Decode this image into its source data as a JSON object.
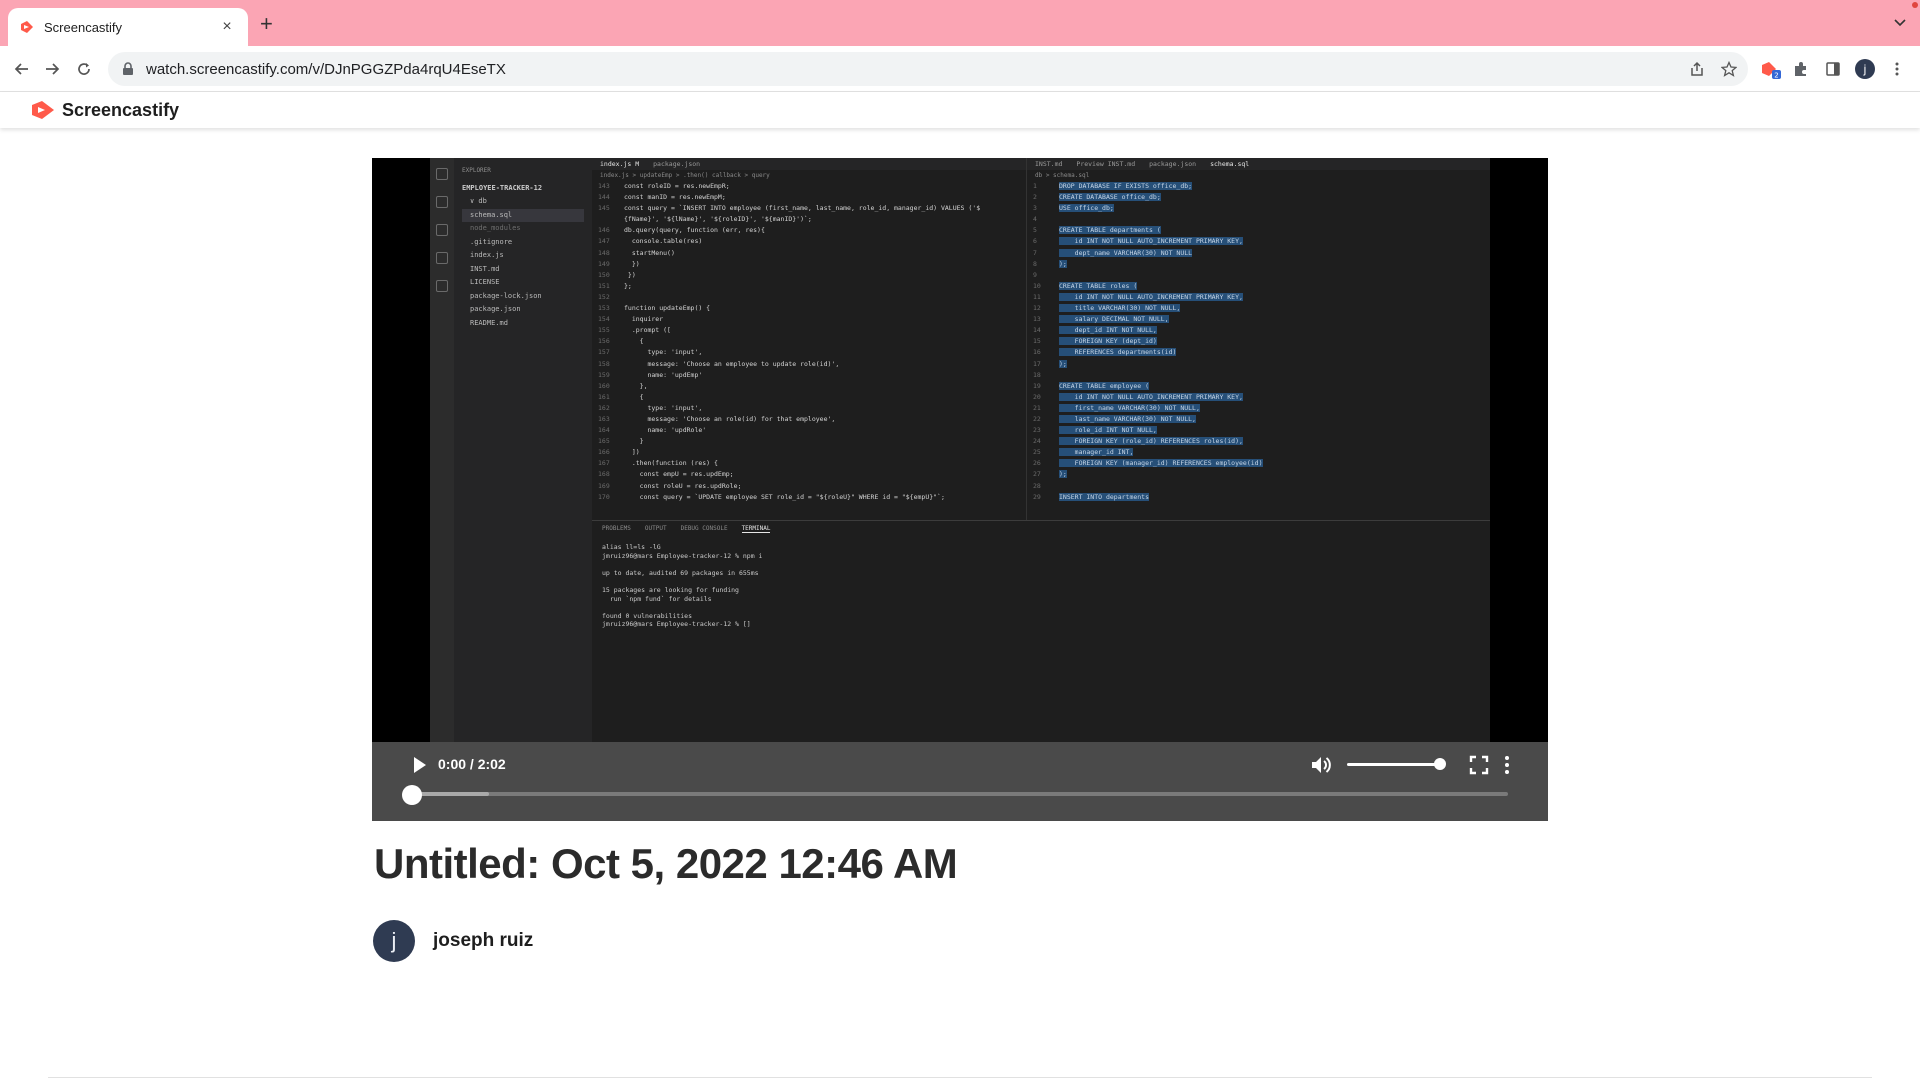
{
  "browser": {
    "tab_title": "Screencastify",
    "url": "watch.screencastify.com/v/DJnPGGZPda4rqU4EseTX",
    "extension_badge": "2",
    "profile_initial": "j"
  },
  "site": {
    "brand_name": "Screencastify",
    "brand_color": "#ff5a4a"
  },
  "player": {
    "time": "0:00 / 2:02",
    "progress_fraction": 0.0,
    "buffered_fraction": 0.07,
    "volume_fraction": 1.0
  },
  "screen_recording": {
    "explorer": {
      "title": "EXPLORER",
      "section": "EMPLOYEE-TRACKER-12",
      "items": [
        {
          "label": "db",
          "kind": "folder"
        },
        {
          "label": "schema.sql",
          "kind": "active"
        },
        {
          "label": "node_modules",
          "kind": "dim"
        },
        {
          "label": ".gitignore",
          "kind": "file"
        },
        {
          "label": "index.js",
          "kind": "file"
        },
        {
          "label": "INST.md",
          "kind": "file"
        },
        {
          "label": "LICENSE",
          "kind": "file"
        },
        {
          "label": "package-lock.json",
          "kind": "file"
        },
        {
          "label": "package.json",
          "kind": "file"
        },
        {
          "label": "README.md",
          "kind": "file"
        }
      ]
    },
    "left_tabs": [
      "index.js M",
      "package.json"
    ],
    "left_breadcrumb": "index.js > updateEmp > .then() callback > query",
    "left_code": [
      [
        "143",
        "const roleID = res.newEmpR;"
      ],
      [
        "144",
        "const manID = res.newEmpM;"
      ],
      [
        "145",
        "const query = `INSERT INTO employee (first_name, last_name, role_id, manager_id) VALUES ('$"
      ],
      [
        "",
        "{fName}', '${lName}', '${roleID}', '${manID}')`;"
      ],
      [
        "146",
        "db.query(query, function (err, res){"
      ],
      [
        "147",
        "  console.table(res)"
      ],
      [
        "148",
        "  startMenu()"
      ],
      [
        "149",
        "  })"
      ],
      [
        "150",
        " })"
      ],
      [
        "151",
        "};"
      ],
      [
        "152",
        ""
      ],
      [
        "153",
        "function updateEmp() {"
      ],
      [
        "154",
        "  inquirer"
      ],
      [
        "155",
        "  .prompt (["
      ],
      [
        "156",
        "    {"
      ],
      [
        "157",
        "      type: 'input',"
      ],
      [
        "158",
        "      message: 'Choose an employee to update role(id)',"
      ],
      [
        "159",
        "      name: 'updEmp'"
      ],
      [
        "160",
        "    },"
      ],
      [
        "161",
        "    {"
      ],
      [
        "162",
        "      type: 'input',"
      ],
      [
        "163",
        "      message: 'Choose an role(id) for that employee',"
      ],
      [
        "164",
        "      name: 'updRole'"
      ],
      [
        "165",
        "    }"
      ],
      [
        "166",
        "  ])"
      ],
      [
        "167",
        "  .then(function (res) {"
      ],
      [
        "168",
        "    const empU = res.updEmp;"
      ],
      [
        "169",
        "    const roleU = res.updRole;"
      ],
      [
        "170",
        "    const query = `UPDATE employee SET role_id = \"${roleU}\" WHERE id = \"${empU}\"`;"
      ]
    ],
    "right_tabs": [
      "INST.md",
      "Preview INST.md",
      "package.json",
      "schema.sql"
    ],
    "right_breadcrumb": "db > schema.sql",
    "right_code": [
      [
        "1",
        "DROP DATABASE IF EXISTS office_db;"
      ],
      [
        "2",
        "CREATE DATABASE office_db;"
      ],
      [
        "3",
        "USE office_db;"
      ],
      [
        "4",
        ""
      ],
      [
        "5",
        "CREATE TABLE departments ("
      ],
      [
        "6",
        "    id INT NOT NULL AUTO_INCREMENT PRIMARY KEY,"
      ],
      [
        "7",
        "    dept_name VARCHAR(30) NOT NULL"
      ],
      [
        "8",
        ");"
      ],
      [
        "9",
        ""
      ],
      [
        "10",
        "CREATE TABLE roles ("
      ],
      [
        "11",
        "    id INT NOT NULL AUTO_INCREMENT PRIMARY KEY,"
      ],
      [
        "12",
        "    title VARCHAR(30) NOT NULL,"
      ],
      [
        "13",
        "    salary DECIMAL NOT NULL,"
      ],
      [
        "14",
        "    dept_id INT NOT NULL,"
      ],
      [
        "15",
        "    FOREIGN KEY (dept_id)"
      ],
      [
        "16",
        "    REFERENCES departments(id)"
      ],
      [
        "17",
        ");"
      ],
      [
        "18",
        ""
      ],
      [
        "19",
        "CREATE TABLE employee ("
      ],
      [
        "20",
        "    id INT NOT NULL AUTO_INCREMENT PRIMARY KEY,"
      ],
      [
        "21",
        "    first_name VARCHAR(30) NOT NULL,"
      ],
      [
        "22",
        "    last_name VARCHAR(30) NOT NULL,"
      ],
      [
        "23",
        "    role_id INT NOT NULL,"
      ],
      [
        "24",
        "    FOREIGN KEY (role_id) REFERENCES roles(id),"
      ],
      [
        "25",
        "    manager_id INT,"
      ],
      [
        "26",
        "    FOREIGN KEY (manager_id) REFERENCES employee(id)"
      ],
      [
        "27",
        ");"
      ],
      [
        "28",
        ""
      ],
      [
        "29",
        "INSERT INTO departments"
      ]
    ],
    "panel_tabs": [
      "PROBLEMS",
      "OUTPUT",
      "DEBUG CONSOLE",
      "TERMINAL"
    ],
    "terminal_lines": [
      "alias ll=ls -lG",
      "jmruiz96@mars Employee-tracker-12 % npm i",
      "",
      "up to date, audited 69 packages in 655ms",
      "",
      "15 packages are looking for funding",
      "  run `npm fund` for details",
      "",
      "found 0 vulnerabilities",
      "jmruiz96@mars Employee-tracker-12 % []"
    ]
  },
  "video": {
    "title": "Untitled: Oct 5, 2022 12:46 AM",
    "author_initial": "j",
    "author_name": "joseph ruiz"
  },
  "colors": {
    "tabstrip": "#fba5b4",
    "controls_bg": "#4a4a4a",
    "avatar_bg": "#2f3b52"
  }
}
